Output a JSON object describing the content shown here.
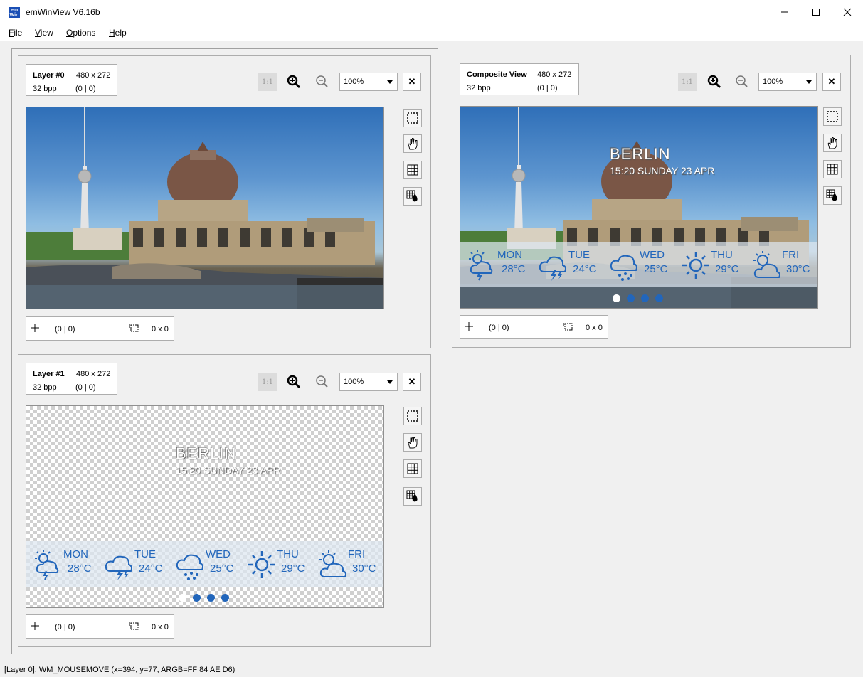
{
  "window": {
    "title": "emWinView V6.16b",
    "icon_text": "em\nWin",
    "minimize_icon": "minimize-icon",
    "maximize_icon": "maximize-icon",
    "close_icon": "close-icon"
  },
  "menu": {
    "items": [
      {
        "key": "F",
        "rest": "ile"
      },
      {
        "key": "V",
        "rest": "iew"
      },
      {
        "key": "O",
        "rest": "ptions"
      },
      {
        "key": "H",
        "rest": "elp"
      }
    ]
  },
  "layer0": {
    "name": "Layer #0",
    "size": "480 x 272",
    "bpp": "32 bpp",
    "pos": "(0 | 0)",
    "zoom_one": "1:1",
    "zoom": "100%",
    "cursor_pos": "(0 | 0)",
    "sel_size": "0 x 0"
  },
  "layer1": {
    "name": "Layer #1",
    "size": "480 x 272",
    "bpp": "32 bpp",
    "pos": "(0 | 0)",
    "zoom_one": "1:1",
    "zoom": "100%",
    "cursor_pos": "(0 | 0)",
    "sel_size": "0 x 0"
  },
  "composite": {
    "name": "Composite View",
    "size": "480 x 272",
    "bpp": "32 bpp",
    "pos": "(0 | 0)",
    "zoom_one": "1:1",
    "zoom": "100%",
    "cursor_pos": "(0 | 0)",
    "sel_size": "0 x 0"
  },
  "weather_ui": {
    "city": "BERLIN",
    "datetime": "15:20 SUNDAY 23 APR",
    "days": [
      {
        "name": "MON",
        "temp": "28°C",
        "icon": "sun-cloud-storm-icon"
      },
      {
        "name": "TUE",
        "temp": "24°C",
        "icon": "cloud-lightning-icon"
      },
      {
        "name": "WED",
        "temp": "25°C",
        "icon": "cloud-rain-icon"
      },
      {
        "name": "THU",
        "temp": "29°C",
        "icon": "sun-icon"
      },
      {
        "name": "FRI",
        "temp": "30°C",
        "icon": "sun-cloud-icon"
      }
    ],
    "page_dots": 4,
    "active_dot": 0,
    "accent_color": "#2266bb"
  },
  "status": {
    "text": "[Layer 0]: WM_MOUSEMOVE (x=394, y=77, ARGB=FF 84 AE D6)"
  }
}
